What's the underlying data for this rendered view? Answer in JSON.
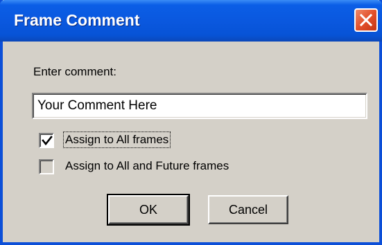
{
  "window": {
    "title": "Frame Comment",
    "close_icon": "close-icon"
  },
  "form": {
    "prompt_label": "Enter comment:",
    "comment_value": "Your Comment Here"
  },
  "options": [
    {
      "label": "Assign to All frames",
      "checked": true
    },
    {
      "label": "Assign to All and Future frames",
      "checked": false
    }
  ],
  "buttons": {
    "ok_label": "OK",
    "cancel_label": "Cancel"
  },
  "colors": {
    "titlebar": "#0a58df",
    "dialog_face": "#d4d0c8",
    "close_button": "#e2502b"
  }
}
